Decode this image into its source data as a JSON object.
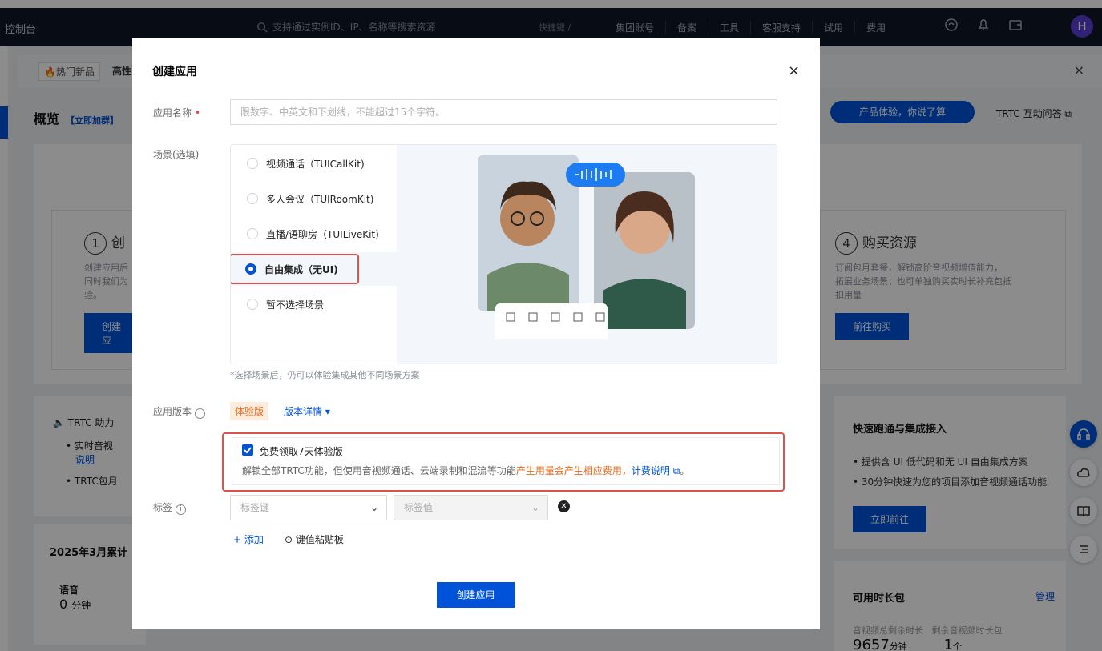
{
  "nav": {
    "brand": "控制台",
    "search_placeholder": "支持通过实例ID、IP、名称等搜索资源",
    "shortcut": "快捷键 /",
    "links": [
      "集团账号",
      "备案",
      "工具",
      "客服支持",
      "试用",
      "费用"
    ],
    "avatar": "H"
  },
  "notice": {
    "hot_tag": "🔥热门新品",
    "text": "高性"
  },
  "page": {
    "overview_title": "概览",
    "join_group": "【立即加群】",
    "feedback_pill": "产品体验，你说了算",
    "qa_link": "TRTC 互动问答 ⧉",
    "step1": {
      "num": "1",
      "title": "创",
      "desc": [
        "创建应用后",
        "同时我们为",
        "验。"
      ],
      "btn": "创建应"
    },
    "step4": {
      "num": "4",
      "title": "购买资源",
      "desc": [
        "订阅包月套餐，解锁高阶音视频增值能力，",
        "拓展业务场景；也可单独购买实时长补充包抵",
        "扣用量"
      ],
      "btn": "前往购买"
    },
    "trtc_helper": "TRTC 助力",
    "bullet1": "• 实时音视",
    "bullet1_link": "说明",
    "bullet2": "• TRTC包月",
    "month_title": "2025年3月累计",
    "voice_label": "语音",
    "voice_value": "0",
    "voice_unit": "分钟",
    "quick_title": "快速跑通与集成接入",
    "quick_b1": "• 提供含 UI 低代码和无 UI 自由集成方案",
    "quick_b2": "• 30分钟快速为您的项目添加音视频通话功能",
    "quick_btn": "立即前往",
    "pkg_title": "可用时长包",
    "pkg_manage": "管理",
    "pkg_col1": "音视频总剩余时长",
    "pkg_col2": "剩余音视频时长包",
    "pkg_val1": "9657",
    "pkg_unit1": "分钟",
    "pkg_val2": "1",
    "pkg_unit2": "个"
  },
  "modal": {
    "title": "创建应用",
    "close": "×",
    "name_label": "应用名称",
    "name_required": "•",
    "name_placeholder": "限数字、中英文和下划线，不能超过15个字符。",
    "scene_label": "场景(选填)",
    "scenes": [
      {
        "label": "视频通话（TUICallKit)",
        "selected": false
      },
      {
        "label": "多人会议（TUIRoomKit)",
        "selected": false
      },
      {
        "label": "直播/语聊房（TUILiveKit)",
        "selected": false
      },
      {
        "label": "自由集成（无UI)",
        "selected": true
      },
      {
        "label": "暂不选择场景",
        "selected": false
      }
    ],
    "scene_hint": "*选择场景后，仍可以体验集成其他不同场景方案",
    "version_label": "应用版本",
    "version_badge": "体验版",
    "version_detail": "版本详情 ▾",
    "trial_title": "免费领取7天体验版",
    "trial_desc_prefix": "解锁全部TRTC功能，但使用音视频通话、云端录制和混流等功能",
    "trial_desc_orange": "产生用量会产生相应费用，",
    "trial_desc_link": "计费说明 ⧉",
    "trial_desc_suffix": "。",
    "tag_label": "标签",
    "tag_key_placeholder": "标签键",
    "tag_value_placeholder": "标签值",
    "add_label": "+ 添加",
    "paste_label": "键值粘贴板",
    "submit_label": "创建应用"
  },
  "colors": {
    "primary": "#0052d9",
    "highlight_border": "#d9534f",
    "orange": "#e86b1c"
  }
}
